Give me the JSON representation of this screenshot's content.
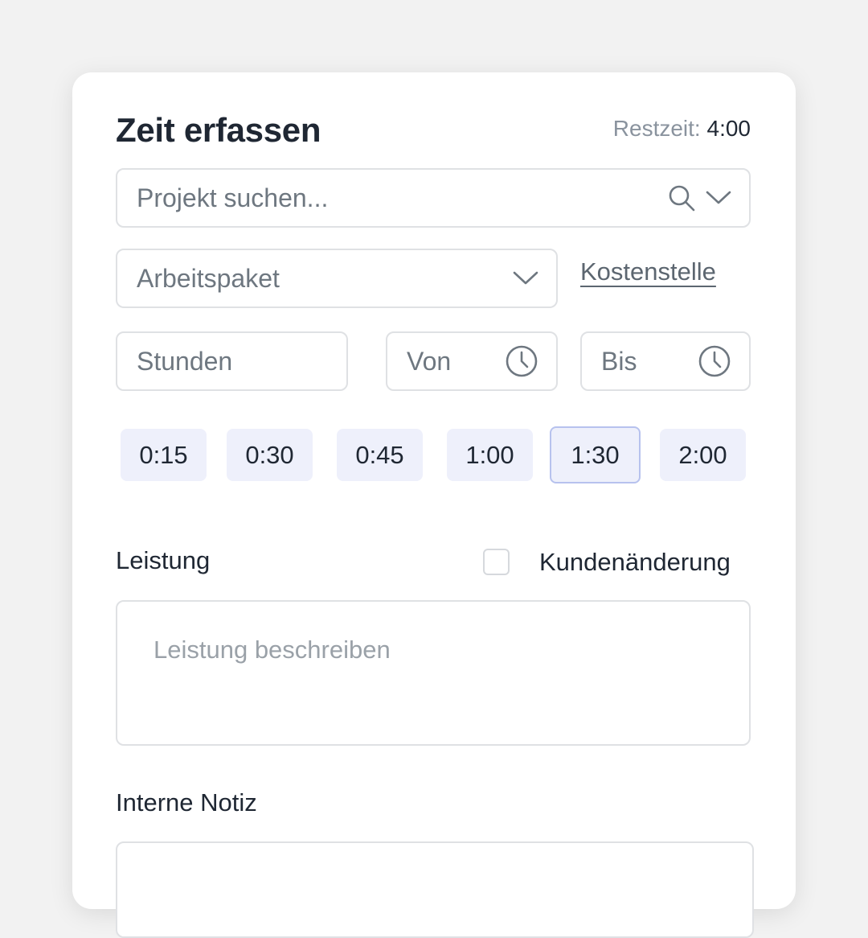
{
  "header": {
    "title": "Zeit erfassen",
    "remaining_label": "Restzeit:",
    "remaining_value": "4:00"
  },
  "project": {
    "placeholder": "Projekt suchen...",
    "icons": [
      "search-icon",
      "chevron-down-icon"
    ]
  },
  "work_package": {
    "placeholder": "Arbeitspaket",
    "icon": "chevron-down-icon"
  },
  "cost_center_link": "Kostenstelle",
  "hours": {
    "placeholder": "Stunden"
  },
  "from": {
    "placeholder": "Von",
    "icon": "clock-icon"
  },
  "to": {
    "placeholder": "Bis",
    "icon": "clock-icon"
  },
  "quick_durations": [
    {
      "label": "0:15",
      "selected": false
    },
    {
      "label": "0:30",
      "selected": false
    },
    {
      "label": "0:45",
      "selected": false
    },
    {
      "label": "1:00",
      "selected": false
    },
    {
      "label": "1:30",
      "selected": true
    },
    {
      "label": "2:00",
      "selected": false
    }
  ],
  "service": {
    "label": "Leistung",
    "placeholder": "Leistung beschreiben"
  },
  "customer_change": {
    "label": "Kundenänderung",
    "checked": false
  },
  "internal_note": {
    "label": "Interne Notiz"
  },
  "colors": {
    "accent_chip_bg": "#eef0fb",
    "accent_chip_border": "#b7c2ee",
    "text_primary": "#1f2733",
    "text_muted": "#6e7780"
  }
}
